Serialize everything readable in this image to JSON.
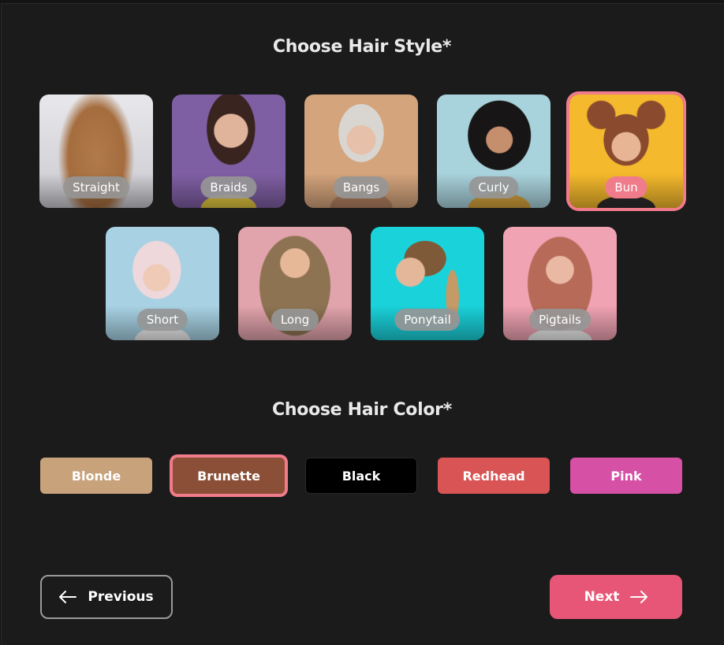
{
  "hair_style": {
    "title": "Choose Hair Style*",
    "selected": "Bun",
    "options": [
      {
        "label": "Straight",
        "selected": false
      },
      {
        "label": "Braids",
        "selected": false
      },
      {
        "label": "Bangs",
        "selected": false
      },
      {
        "label": "Curly",
        "selected": false
      },
      {
        "label": "Bun",
        "selected": true
      },
      {
        "label": "Short",
        "selected": false
      },
      {
        "label": "Long",
        "selected": false
      },
      {
        "label": "Ponytail",
        "selected": false
      },
      {
        "label": "Pigtails",
        "selected": false
      }
    ]
  },
  "hair_color": {
    "title": "Choose Hair Color*",
    "selected": "Brunette",
    "options": [
      {
        "label": "Blonde",
        "color": "#c8a27b",
        "selected": false
      },
      {
        "label": "Brunette",
        "color": "#8a4f36",
        "selected": true
      },
      {
        "label": "Black",
        "color": "#000000",
        "selected": false
      },
      {
        "label": "Redhead",
        "color": "#d95454",
        "selected": false
      },
      {
        "label": "Pink",
        "color": "#d650a6",
        "selected": false
      }
    ]
  },
  "navigation": {
    "previous_label": "Previous",
    "next_label": "Next"
  },
  "colors": {
    "accent": "#f07b8a",
    "next_button": "#e75676",
    "background": "#1b1b1b"
  }
}
